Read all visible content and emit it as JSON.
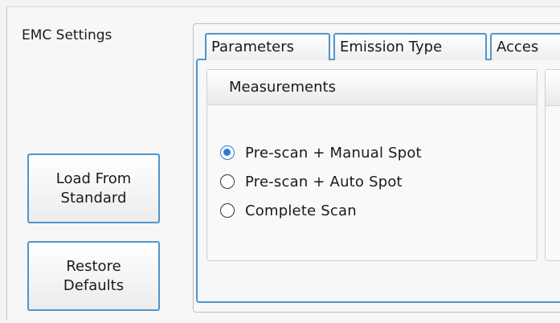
{
  "title": "EMC Settings",
  "buttons": {
    "load_line1": "Load From",
    "load_line2": "Standard",
    "restore_line1": "Restore",
    "restore_line2": "Defaults"
  },
  "tabs": [
    {
      "label": "Parameters",
      "active": true
    },
    {
      "label": "Emission Type",
      "active": false
    },
    {
      "label": "Acces",
      "active": false
    }
  ],
  "measurements": {
    "header": "Measurements",
    "options": [
      {
        "label": "Pre-scan + Manual Spot",
        "checked": true
      },
      {
        "label": "Pre-scan + Auto Spot",
        "checked": false
      },
      {
        "label": "Complete Scan",
        "checked": false
      }
    ]
  },
  "colors": {
    "accent": "#4f95cc",
    "radio_selected": "#2b7cd3"
  }
}
